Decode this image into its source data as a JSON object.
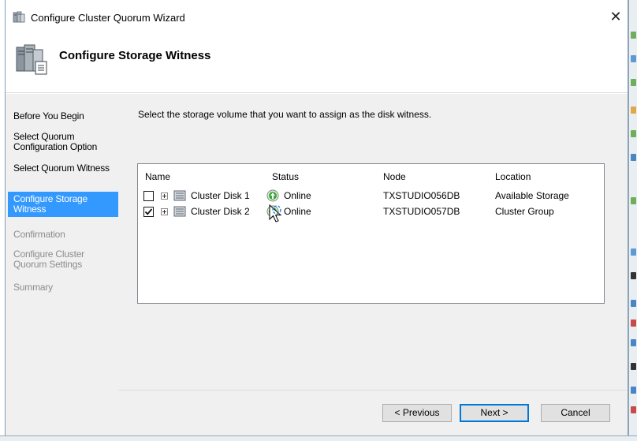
{
  "window": {
    "title": "Configure Cluster Quorum Wizard",
    "close_label": "✕"
  },
  "header": {
    "title": "Configure Storage Witness"
  },
  "nav": {
    "items": [
      {
        "label": "Before You Begin",
        "state": "normal"
      },
      {
        "label": "Select Quorum Configuration Option",
        "state": "normal"
      },
      {
        "label": "Select Quorum Witness",
        "state": "normal"
      },
      {
        "label": "Configure Storage Witness",
        "state": "active"
      },
      {
        "label": "Confirmation",
        "state": "disabled"
      },
      {
        "label": "Configure Cluster Quorum Settings",
        "state": "disabled"
      },
      {
        "label": "Summary",
        "state": "disabled"
      }
    ]
  },
  "main": {
    "instruction": "Select the storage volume that you want to assign as the disk witness.",
    "table": {
      "columns": [
        "Name",
        "Status",
        "Node",
        "Location"
      ],
      "rows": [
        {
          "checked": false,
          "name": "Cluster Disk 1",
          "status": "Online",
          "node": "TXSTUDIO056DB",
          "location": "Available Storage"
        },
        {
          "checked": true,
          "name": "Cluster Disk 2",
          "status": "Online",
          "node": "TXSTUDIO057DB",
          "location": "Cluster Group"
        }
      ]
    }
  },
  "footer": {
    "previous_label": "< Previous",
    "next_label": "Next >",
    "cancel_label": "Cancel"
  },
  "colors": {
    "nav_active": "#3399ff",
    "nav_disabled_text": "#8c8c8c",
    "status_online": "#3aa53a"
  },
  "icons": {
    "title": "cluster-wizard-icon",
    "header": "storage-witness-icon",
    "disk": "cluster-disk-icon",
    "status": "online-status-icon"
  }
}
